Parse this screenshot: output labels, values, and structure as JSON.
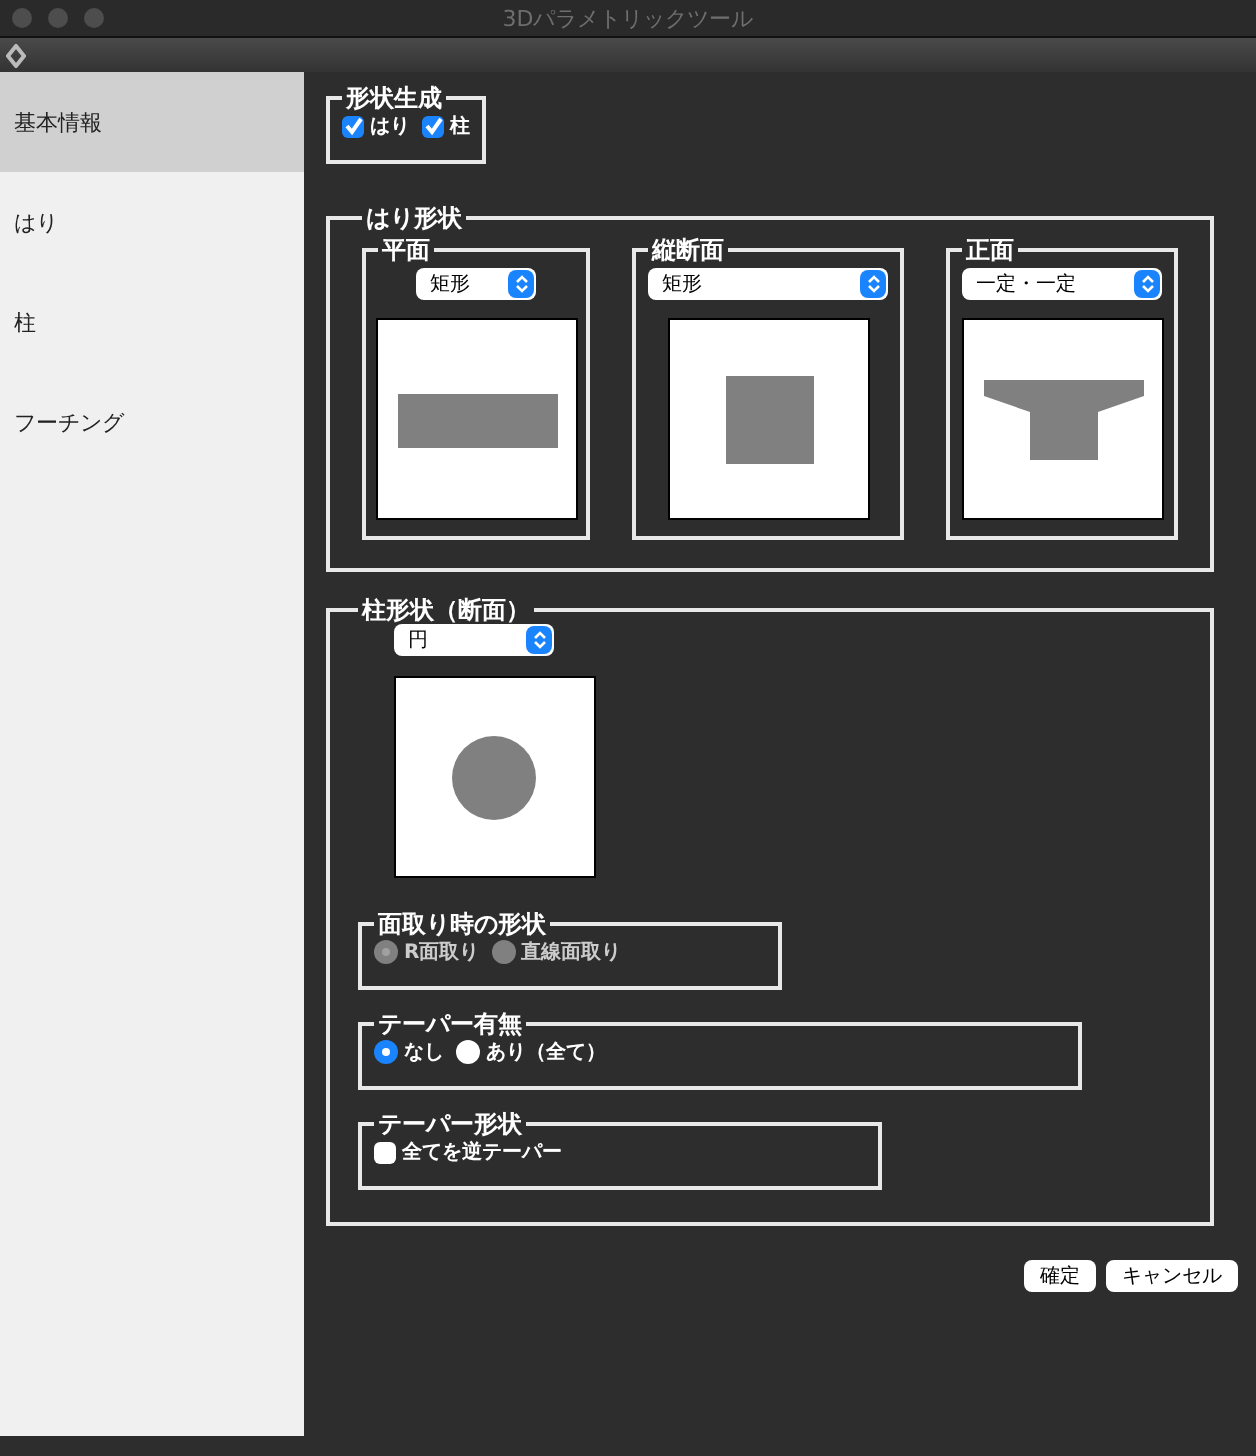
{
  "window": {
    "title": "3Dパラメトリックツール"
  },
  "sidebar": {
    "items": [
      {
        "label": "基本情報",
        "selected": true
      },
      {
        "label": "はり",
        "selected": false
      },
      {
        "label": "柱",
        "selected": false
      },
      {
        "label": "フーチング",
        "selected": false
      }
    ]
  },
  "shape_generation": {
    "legend": "形状生成",
    "options": [
      {
        "label": "はり",
        "checked": true
      },
      {
        "label": "柱",
        "checked": true
      }
    ]
  },
  "beam_shape": {
    "legend": "はり形状",
    "panels": [
      {
        "legend": "平面",
        "select": "矩形"
      },
      {
        "legend": "縦断面",
        "select": "矩形"
      },
      {
        "legend": "正面",
        "select": "一定・一定"
      }
    ]
  },
  "column_shape": {
    "legend": "柱形状（断面）",
    "select": "円",
    "chamfer": {
      "legend": "面取り時の形状",
      "disabled": true,
      "options": [
        {
          "label": "R面取り",
          "selected": true
        },
        {
          "label": "直線面取り",
          "selected": false
        }
      ]
    },
    "taper": {
      "legend": "テーパー有無",
      "disabled": false,
      "options": [
        {
          "label": "なし",
          "selected": true
        },
        {
          "label": "あり（全て）",
          "selected": false
        }
      ]
    },
    "taper_shape": {
      "legend": "テーパー形状",
      "options": [
        {
          "label": "全てを逆テーパー",
          "checked": false
        }
      ]
    }
  },
  "buttons": [
    "確定",
    "キャンセル"
  ]
}
